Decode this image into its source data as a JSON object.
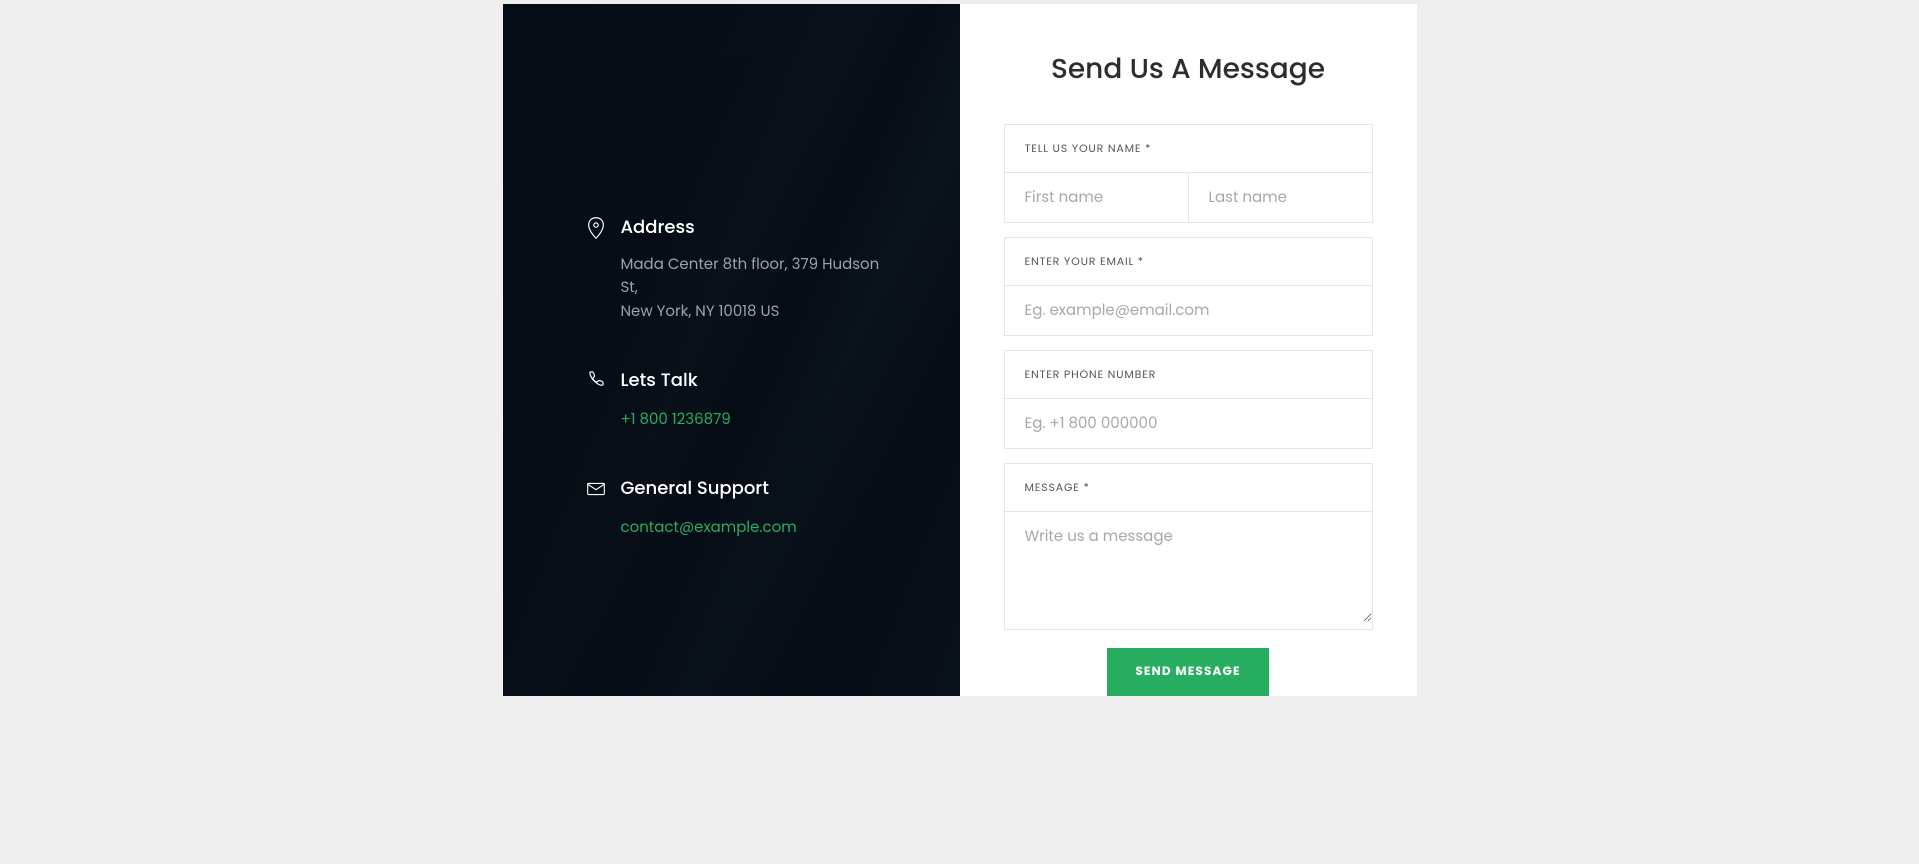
{
  "left": {
    "address": {
      "title": "Address",
      "line1": "Mada Center 8th floor, 379 Hudson St,",
      "line2": "New York, NY 10018 US"
    },
    "phone": {
      "title": "Lets Talk",
      "value": "+1 800 1236879"
    },
    "support": {
      "title": "General Support",
      "value": "contact@example.com"
    }
  },
  "form": {
    "title": "Send Us A Message",
    "name_label": "TELL US YOUR NAME *",
    "first_name_placeholder": "First name",
    "last_name_placeholder": "Last name",
    "email_label": "ENTER YOUR EMAIL *",
    "email_placeholder": "Eg. example@email.com",
    "phone_label": "ENTER PHONE NUMBER",
    "phone_placeholder": "Eg. +1 800 000000",
    "message_label": "MESSAGE *",
    "message_placeholder": "Write us a message",
    "submit_label": "SEND MESSAGE"
  }
}
